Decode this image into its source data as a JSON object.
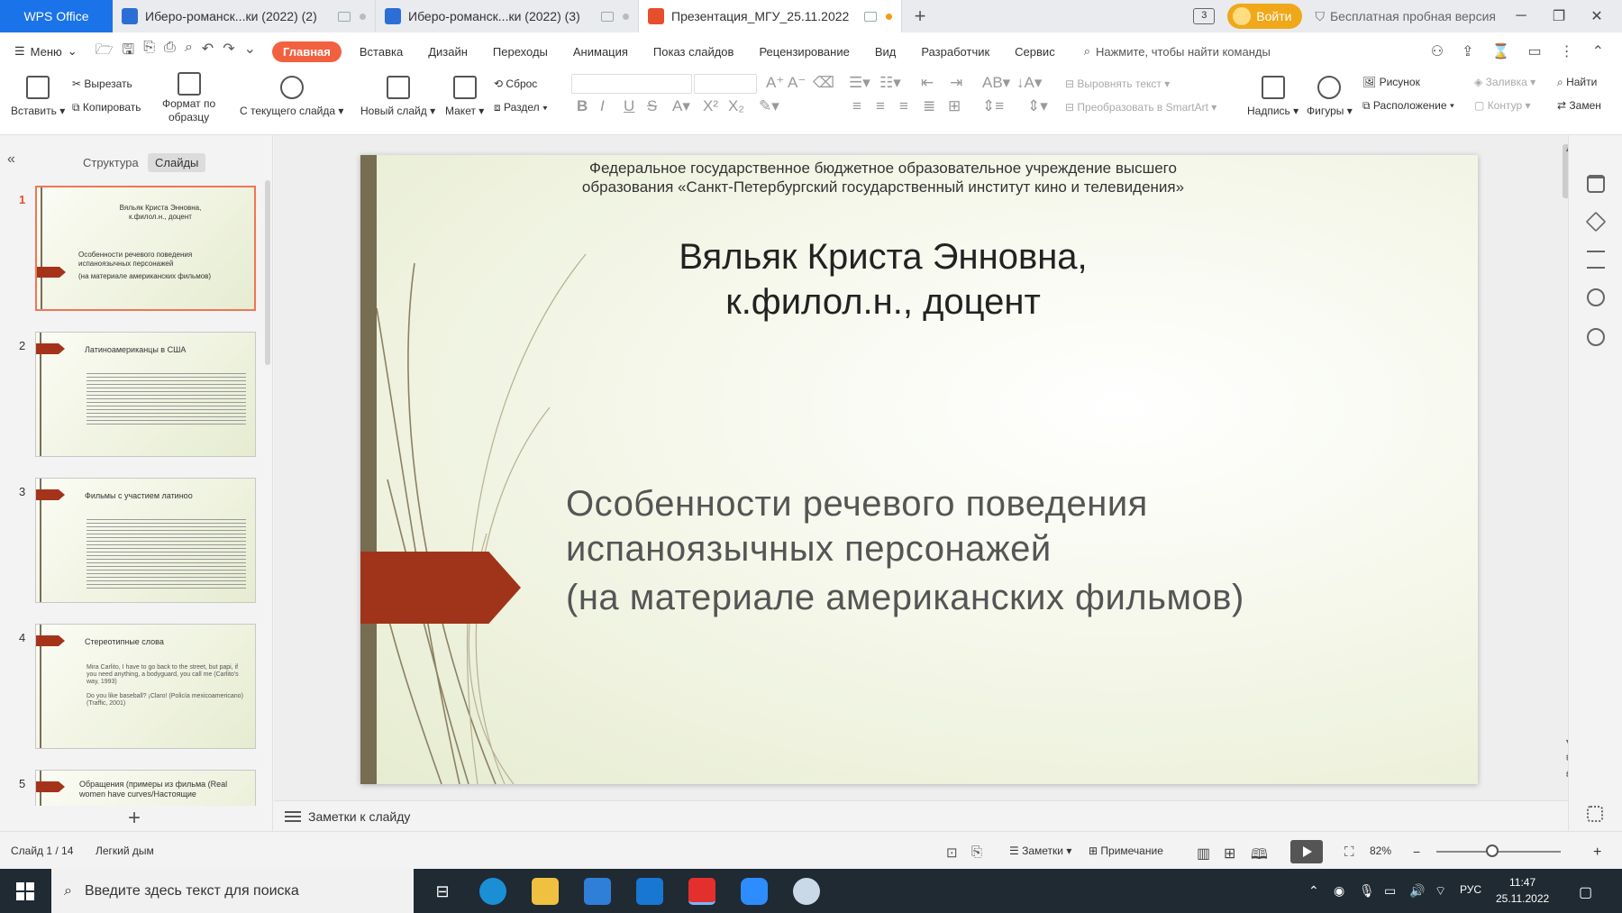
{
  "titlebar": {
    "brand": "WPS Office",
    "tabs": [
      {
        "title": "Иберо-романск...ки (2022) (2)",
        "app": "writer"
      },
      {
        "title": "Иберо-романск...ки (2022) (3)",
        "app": "writer"
      },
      {
        "title": "Презентация_МГУ_25.11.2022",
        "app": "presentation",
        "active": true
      }
    ],
    "badge_count": "3",
    "login": "Войти",
    "trial": "Бесплатная пробная версия"
  },
  "menu": {
    "menu_label": "Меню",
    "items": [
      "Главная",
      "Вставка",
      "Дизайн",
      "Переходы",
      "Анимация",
      "Показ слайдов",
      "Рецензирование",
      "Вид",
      "Разработчик",
      "Сервис"
    ],
    "search_placeholder": "Нажмите, чтобы найти команды"
  },
  "ribbon": {
    "paste": "Вставить",
    "cut": "Вырезать",
    "copy": "Копировать",
    "format_painter_1": "Формат по",
    "format_painter_2": "образцу",
    "from_current": "С текущего слайда",
    "new_slide": "Новый слайд",
    "layout": "Макет",
    "reset": "Сброс",
    "section": "Раздел",
    "align_text": "Выровнять текст",
    "smartart": "Преобразовать в SmartArt",
    "textbox": "Надпись",
    "shapes": "Фигуры",
    "picture": "Рисунок",
    "arrange": "Расположение",
    "fill": "Заливка",
    "outline": "Контур",
    "find": "Найти",
    "replace": "Замен"
  },
  "left_panel": {
    "tab_structure": "Структура",
    "tab_slides": "Слайды",
    "thumbnails": [
      {
        "num": "1",
        "title": "Вяльяк Криста Энновна, к.филол.н., доцент",
        "line2": "Особенности речевого поведения испаноязычных персонажей",
        "line3": "(на материале американских фильмов)"
      },
      {
        "num": "2",
        "title": "Латиноамериканцы в США"
      },
      {
        "num": "3",
        "title": "Фильмы с участием латиноо"
      },
      {
        "num": "4",
        "title": "Стереотипные слова",
        "b1": "Mira Carlito, I have to go back to the street, but papi, if you need anything, a bodyguard, you call me (Carlito's way, 1993)",
        "b2": "Do you like baseball? ¡Claro! (Policía mexicoamericano) (Traffic, 2001)"
      },
      {
        "num": "5",
        "title": "Обращения (примеры из фильма (Real women have curves/Настоящие"
      }
    ]
  },
  "slide": {
    "institution": "Федеральное государственное бюджетное образовательное учреждение высшего образования «Санкт-Петербургский государственный институт кино и телевидения»",
    "author_line1": "Вяльяк Криста Энновна,",
    "author_line2": "к.филол.н., доцент",
    "title_line1": "Особенности речевого поведения",
    "title_line2": "испаноязычных персонажей",
    "subtitle": "(на материале американских фильмов)",
    "accent_color": "#a0341a",
    "bar_color": "#766d53"
  },
  "notes": {
    "label": "Заметки к слайду"
  },
  "status": {
    "slide_counter": "Слайд 1 / 14",
    "theme": "Легкий дым",
    "notes": "Заметки",
    "comment": "Примечание",
    "zoom": "82%",
    "zoom_level": 0.45
  },
  "taskbar": {
    "search_placeholder": "Введите здесь текст для поиска",
    "lang": "РУС",
    "time": "11:47",
    "date": "25.11.2022"
  }
}
